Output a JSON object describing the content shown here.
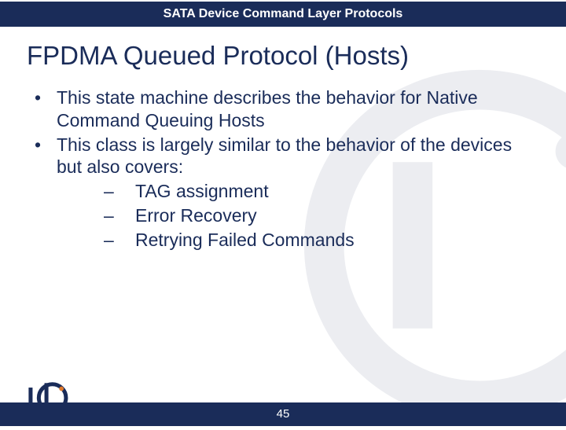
{
  "header": {
    "subtitle": "SATA Device Command Layer Protocols"
  },
  "title": "FPDMA Queued Protocol (Hosts)",
  "bullets": [
    {
      "text": "This state machine describes the behavior for Native Command Queuing Hosts"
    },
    {
      "text": "This class is largely similar to the behavior of the devices but also covers:"
    }
  ],
  "subbullets": [
    {
      "text": "TAG assignment"
    },
    {
      "text": "Error Recovery"
    },
    {
      "text": "Retrying Failed Commands"
    }
  ],
  "footer": {
    "page_number": "45"
  }
}
